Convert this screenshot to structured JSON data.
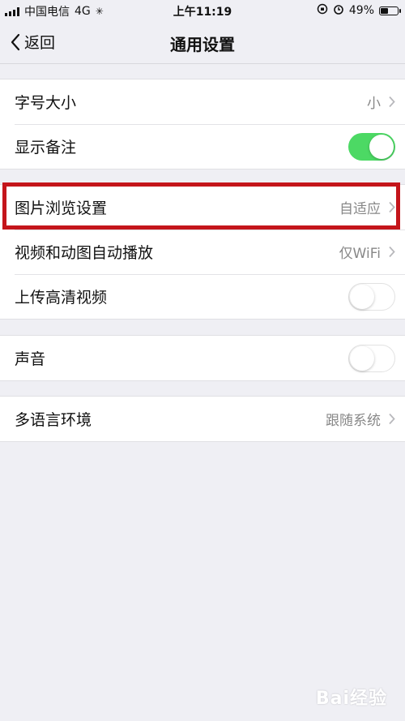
{
  "status_bar": {
    "carrier": "中国电信",
    "network": "4G",
    "time": "上午11:19",
    "battery": "49%",
    "battery_level": 0.49
  },
  "nav": {
    "back_label": "返回",
    "title": "通用设置"
  },
  "groups": [
    [
      {
        "label": "字号大小",
        "value": "小",
        "chevron": true
      },
      {
        "label": "显示备注",
        "toggle": "on"
      }
    ],
    [
      {
        "label": "图片浏览设置",
        "value": "自适应",
        "chevron": true,
        "highlighted": true
      },
      {
        "label": "视频和动图自动播放",
        "value": "仅WiFi",
        "chevron": true
      },
      {
        "label": "上传高清视频",
        "toggle": "off"
      }
    ],
    [
      {
        "label": "声音",
        "toggle": "off"
      }
    ],
    [
      {
        "label": "多语言环境",
        "value": "跟随系统",
        "chevron": true
      }
    ]
  ],
  "colors": {
    "toggle_on": "#4cd964",
    "highlight_border": "#c4151b"
  },
  "watermark": "Bai经验"
}
